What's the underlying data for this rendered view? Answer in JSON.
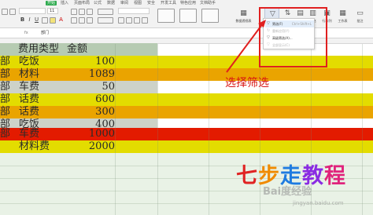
{
  "ribbon": {
    "tabs": [
      {
        "label": "开始",
        "active": true
      },
      {
        "label": "插入",
        "active": false
      },
      {
        "label": "页面布局",
        "active": false
      },
      {
        "label": "公式",
        "active": false
      },
      {
        "label": "数据",
        "active": false
      },
      {
        "label": "审阅",
        "active": false
      },
      {
        "label": "视图",
        "active": false
      },
      {
        "label": "安全",
        "active": false
      },
      {
        "label": "开发工具",
        "active": false
      },
      {
        "label": "特色应用",
        "active": false
      },
      {
        "label": "文档助手",
        "active": false
      }
    ],
    "font_size_value": "11",
    "buttons": {
      "pivot": "数据透视表",
      "filter": "自动筛选",
      "sort": "排序",
      "format": "格式",
      "fill": "填充",
      "rowcol": "行和列",
      "worksheet": "工作表",
      "comment": "批注"
    }
  },
  "filter_menu": {
    "items": [
      {
        "label": "筛选(F)",
        "shortcut": "Ctrl+Shift+L",
        "icon": "filter-icon",
        "disabled": false,
        "highlighted": true
      },
      {
        "label": "重新应用(Y)",
        "shortcut": "",
        "icon": "reapply-icon",
        "disabled": true,
        "highlighted": false
      },
      {
        "label": "高级筛选(A)...",
        "shortcut": "",
        "icon": "advanced-filter-icon",
        "disabled": false,
        "highlighted": false
      },
      {
        "label": "全部显示(C)",
        "shortcut": "",
        "icon": "show-all-icon",
        "disabled": true,
        "highlighted": false
      }
    ]
  },
  "annotation": "选择筛选",
  "formula_bar": {
    "name_box": "",
    "fx": "fx",
    "content": "部门"
  },
  "sheet": {
    "header": {
      "col_a": "",
      "col_b": "费用类型",
      "col_c": "金额"
    },
    "rows": [
      {
        "dept": "部",
        "type": "吃饭",
        "amount": "100",
        "color": "#e3dc00"
      },
      {
        "dept": "部",
        "type": "材料",
        "amount": "1089",
        "color": "#eaa400"
      },
      {
        "dept": "部",
        "type": "车费",
        "amount": "50",
        "color": "#cdd2c8"
      },
      {
        "dept": "部",
        "type": "话费",
        "amount": "600",
        "color": "#e3dc00"
      },
      {
        "dept": "部",
        "type": "话费",
        "amount": "300",
        "color": "#eaa400"
      },
      {
        "dept": "部",
        "type": "吃饭",
        "amount": "400",
        "color": "#cdd2c8"
      },
      {
        "dept": "部",
        "type": "车费",
        "amount": "1000",
        "color": "#e31b00"
      },
      {
        "dept": "",
        "type": "材料费",
        "amount": "2000",
        "color": "#e3dc00"
      }
    ],
    "header_color": "#b6cbb2"
  },
  "watermark": {
    "title": "七步走教程",
    "title_colors": [
      "#e02323",
      "#f08a00",
      "#1f7be0",
      "#8a2be2",
      "#e0237c"
    ],
    "subtitle": "Bai度经验",
    "url": "jingyan.baidu.com"
  }
}
